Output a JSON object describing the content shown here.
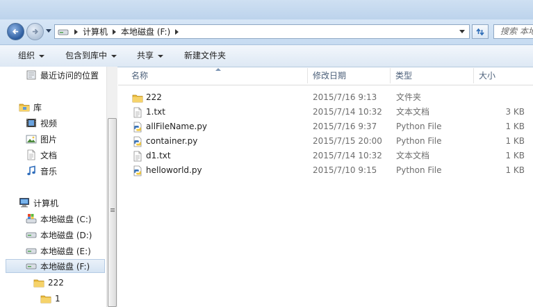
{
  "address": {
    "crumbs": [
      "计算机",
      "本地磁盘 (F:)"
    ]
  },
  "search": {
    "placeholder": "搜索 本地"
  },
  "toolbar": {
    "organize": "组织",
    "include_in_library": "包含到库中",
    "share": "共享",
    "new_folder": "新建文件夹"
  },
  "nav": {
    "recent": "最近访问的位置",
    "libraries": "库",
    "videos": "视频",
    "pictures": "图片",
    "documents": "文档",
    "music": "音乐",
    "computer": "计算机",
    "drives": [
      "本地磁盘 (C:)",
      "本地磁盘 (D:)",
      "本地磁盘 (E:)",
      "本地磁盘 (F:)"
    ],
    "folders": [
      "222",
      "1"
    ]
  },
  "columns": {
    "name": "名称",
    "modified": "修改日期",
    "type": "类型",
    "size": "大小"
  },
  "files": [
    {
      "name": "222",
      "modified": "2015/7/16 9:13",
      "type": "文件夹",
      "size": "",
      "icon": "folder-icon"
    },
    {
      "name": "1.txt",
      "modified": "2015/7/14 10:32",
      "type": "文本文档",
      "size": "3 KB",
      "icon": "text-file-icon"
    },
    {
      "name": "allFileName.py",
      "modified": "2015/7/16 9:37",
      "type": "Python File",
      "size": "1 KB",
      "icon": "python-file-icon"
    },
    {
      "name": "container.py",
      "modified": "2015/7/15 20:00",
      "type": "Python File",
      "size": "1 KB",
      "icon": "python-file-icon"
    },
    {
      "name": "d1.txt",
      "modified": "2015/7/14 10:32",
      "type": "文本文档",
      "size": "1 KB",
      "icon": "text-file-icon"
    },
    {
      "name": "helloworld.py",
      "modified": "2015/7/10 9:15",
      "type": "Python File",
      "size": "1 KB",
      "icon": "python-file-icon"
    }
  ],
  "colors": {
    "accent": "#2c5c9e",
    "folder": "#f0c54a",
    "selection": "#d5e4f3"
  }
}
